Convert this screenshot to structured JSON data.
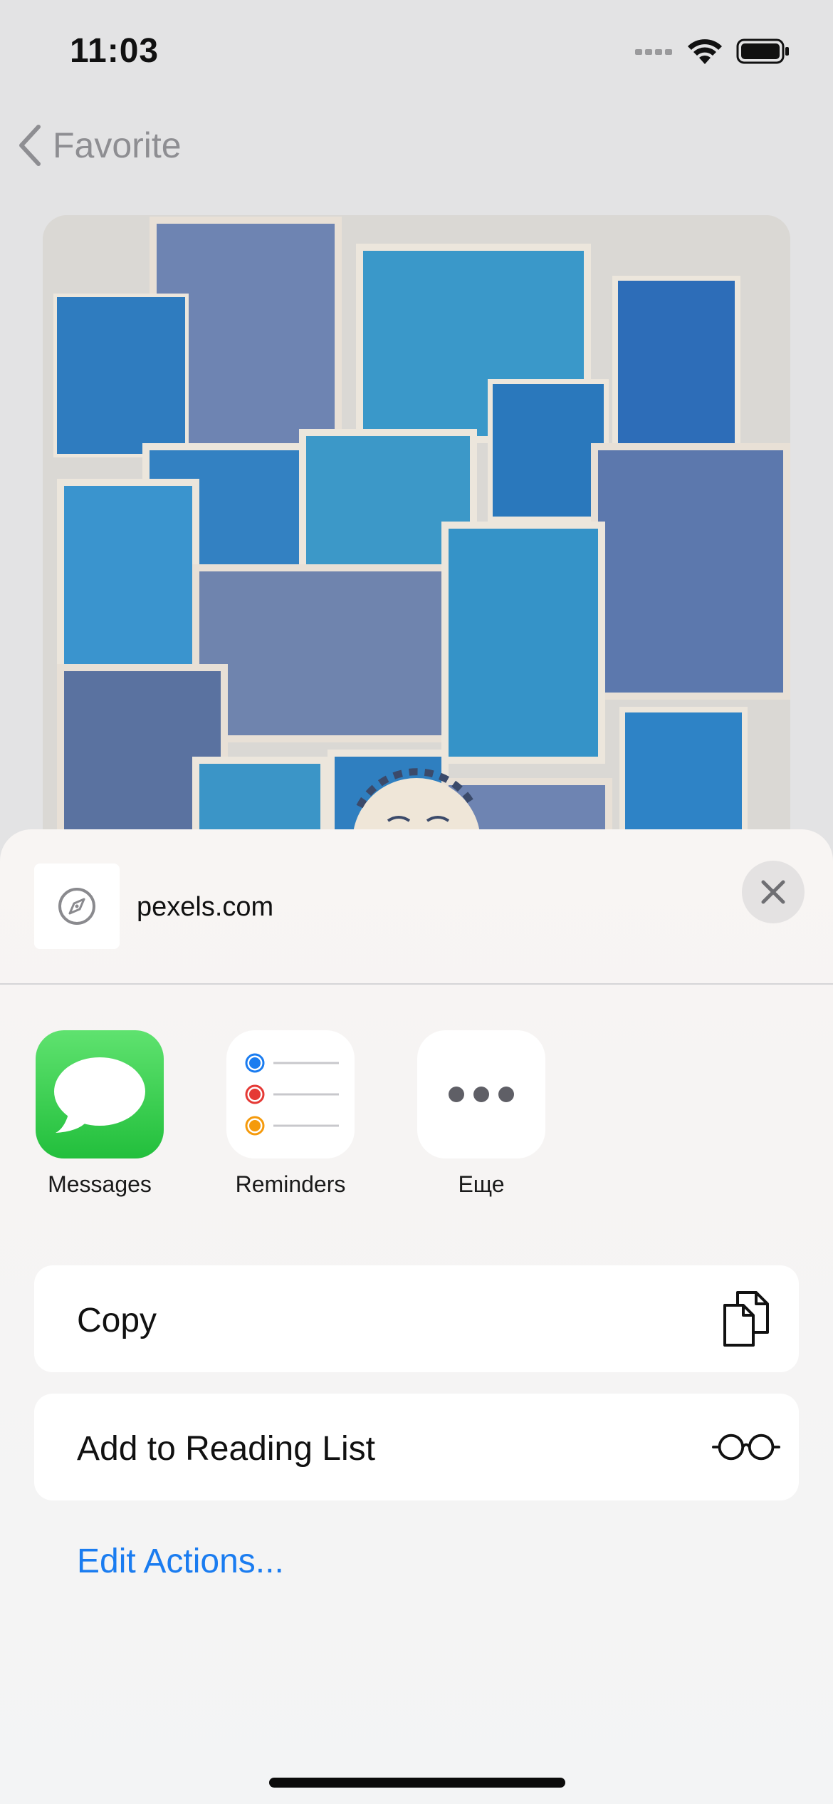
{
  "status_bar": {
    "time": "11:03"
  },
  "nav": {
    "back_label": "Favorite"
  },
  "share_sheet": {
    "site": "pexels.com",
    "apps": [
      {
        "label": "Messages",
        "icon": "messages-icon"
      },
      {
        "label": "Reminders",
        "icon": "reminders-icon"
      },
      {
        "label": "Еще",
        "icon": "more-icon"
      }
    ],
    "actions": [
      {
        "label": "Copy",
        "icon": "copy-icon"
      },
      {
        "label": "Add to Reading List",
        "icon": "reading-list-icon"
      }
    ],
    "edit_actions": "Edit Actions..."
  },
  "colors": {
    "accent": "#1a7cf0",
    "messages_green": "#2fc64a",
    "reminder_blue": "#1a7cf0",
    "reminder_red": "#e53935",
    "reminder_orange": "#f59a0c"
  }
}
